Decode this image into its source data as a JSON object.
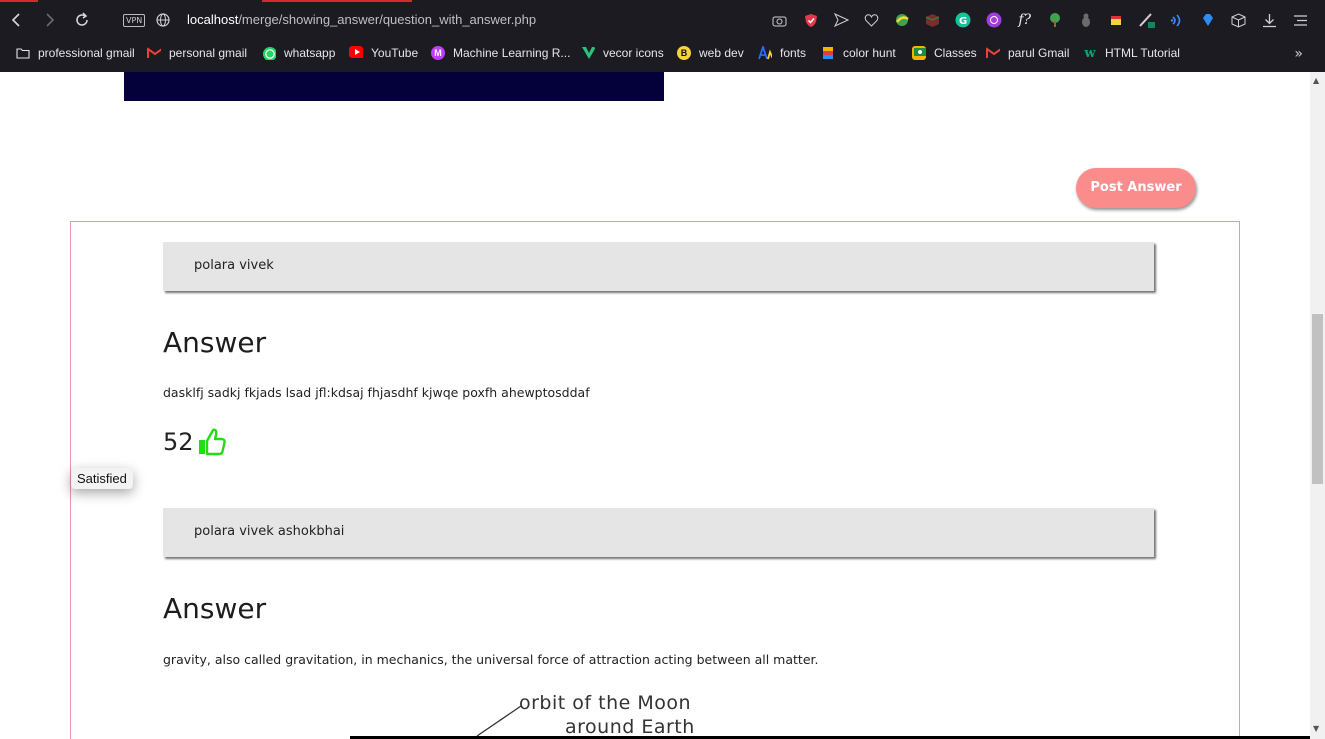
{
  "browser": {
    "url_host": "localhost",
    "url_path": "/merge/showing_answer/question_with_answer.php",
    "vpn_label": "VPN",
    "extensions": [
      "camera-icon",
      "shield-icon",
      "send-icon",
      "heart-icon",
      "ext-icon",
      "cube-icon",
      "grammarly-icon",
      "ext-icon",
      "f?",
      "tree-icon",
      "bug-icon",
      "ext-icon",
      "pen-icon",
      "wifi-icon",
      "diamond-icon",
      "box-icon",
      "download-icon",
      "menu-icon"
    ],
    "bookmarks": [
      {
        "label": "professional gmail",
        "icon": "folder-icon",
        "color": "#e6e6ea"
      },
      {
        "label": "personal gmail",
        "icon": "gmail-icon",
        "color": "#ea4335"
      },
      {
        "label": "whatsapp",
        "icon": "whatsapp-icon",
        "color": "#25d366"
      },
      {
        "label": "YouTube",
        "icon": "youtube-icon",
        "color": "#ff0000"
      },
      {
        "label": "Machine Learning R...",
        "icon": "m-icon",
        "color": "#c13cff"
      },
      {
        "label": "vecor icons",
        "icon": "v-icon",
        "color": "#27c27c"
      },
      {
        "label": "web dev",
        "icon": "b-icon",
        "color": "#f5d33b"
      },
      {
        "label": "fonts",
        "icon": "fonts-icon",
        "color": "#2a6cff"
      },
      {
        "label": "color hunt",
        "icon": "colorhunt-icon",
        "color": "#f4b400"
      },
      {
        "label": "Classes",
        "icon": "classroom-icon",
        "color": "#f4b400"
      },
      {
        "label": "parul Gmail",
        "icon": "gmail-icon",
        "color": "#ea4335"
      },
      {
        "label": "HTML Tutorial",
        "icon": "w3-icon",
        "color": "#04aa6d"
      }
    ],
    "more": "»"
  },
  "page": {
    "post_answer": "Post Answer",
    "answers": [
      {
        "user": "polara vivek",
        "heading": "Answer",
        "text": "dasklfj sadkj fkjads lsad jfl:kdsaj fhjasdhf kjwqe poxfh ahewptosddaf",
        "likes": "52"
      },
      {
        "user": "polara vivek ashokbhai",
        "heading": "Answer",
        "text": "gravity, also called gravitation, in mechanics, the universal force of attraction acting between all matter."
      }
    ],
    "tooltip": "Satisfied",
    "diagram_label_1": "orbit of the Moon",
    "diagram_label_2": "around Earth",
    "colors": {
      "post_button": "#fa8c8c",
      "like_icon": "#22dd11",
      "box_border": "#e89aa3",
      "banner": "#03003a"
    }
  }
}
